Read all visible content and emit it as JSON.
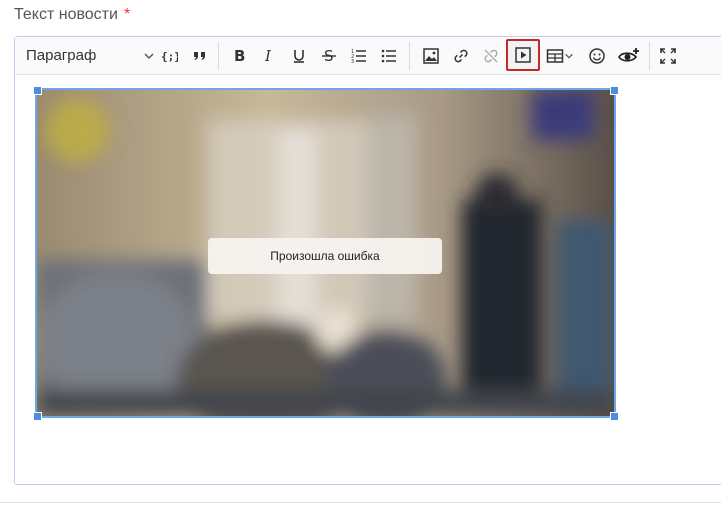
{
  "field": {
    "label": "Текст новости",
    "required_mark": "*"
  },
  "toolbar": {
    "heading": "Параграф",
    "buttons": [
      {
        "name": "code-block-icon"
      },
      {
        "name": "blockquote-icon"
      },
      {
        "name": "bold-icon"
      },
      {
        "name": "italic-icon"
      },
      {
        "name": "underline-icon"
      },
      {
        "name": "strikethrough-icon"
      },
      {
        "name": "numbered-list-icon"
      },
      {
        "name": "bulleted-list-icon"
      },
      {
        "name": "insert-image-icon"
      },
      {
        "name": "link-icon"
      },
      {
        "name": "unlink-icon"
      },
      {
        "name": "media-embed-icon",
        "active": true
      },
      {
        "name": "table-icon"
      },
      {
        "name": "emoji-icon"
      },
      {
        "name": "preview-icon"
      },
      {
        "name": "fullscreen-icon"
      }
    ]
  },
  "media": {
    "error_text": "Произошла ошибка"
  },
  "colors": {
    "selection": "#6fa6e8",
    "active_outline": "#c62828",
    "required": "#e53935"
  }
}
